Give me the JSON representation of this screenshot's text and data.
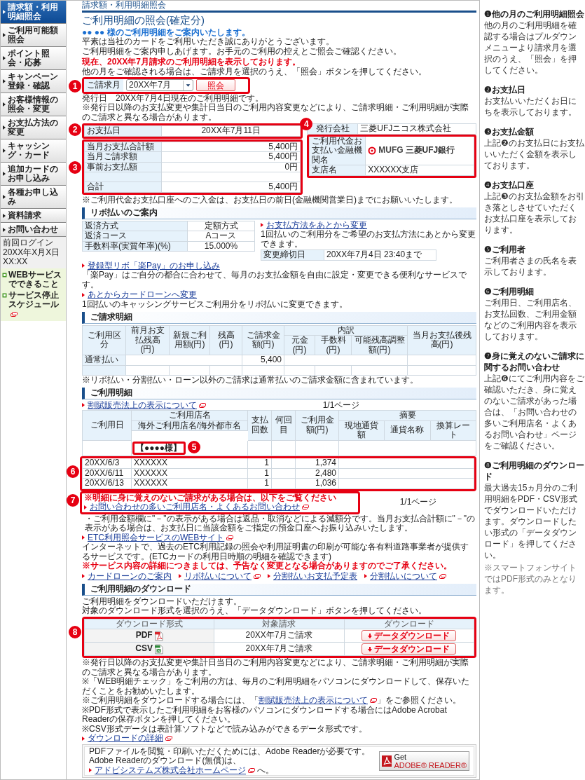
{
  "sidebar": {
    "items": [
      {
        "label": "請求額・利用明細照会",
        "selected": true
      },
      {
        "label": "ご利用可能額照会",
        "selected": false
      },
      {
        "label": "ポイント照会・応募",
        "selected": false
      },
      {
        "label": "キャンペーン登録・確認",
        "selected": false
      },
      {
        "label": "お客様情報の照会・変更",
        "selected": false
      },
      {
        "label": "お支払方法の変更",
        "selected": false
      },
      {
        "label": "キャッシング・カード",
        "selected": false
      },
      {
        "label": "追加カードのお申し込み",
        "selected": false
      },
      {
        "label": "各種お申し込み",
        "selected": false
      },
      {
        "label": "資料請求",
        "selected": false
      },
      {
        "label": "お問い合わせ",
        "selected": false
      }
    ],
    "last_login": {
      "label": "前回ログイン",
      "value": "20XX年X月X日 XX:XX"
    },
    "links": [
      {
        "label": "WEBサービスでできること",
        "external": false
      },
      {
        "label": "サービス停止スケジュール",
        "external": true
      }
    ]
  },
  "breadcrumb": "請求額・利用明細照会",
  "title": "ご利用明細の照会(確定分)",
  "greeting": "●● ●● 様のご利用明細をご案内いたします。",
  "intro": [
    "平素は当社のカードをご利用いただき誠にありがとうございます。",
    "ご利用明細をご案内申しあげます。お手元のご利用の控えとご照会ご確認ください。"
  ],
  "current_notice": "現在、20XX年7月請求のご利用明細を表示しております。",
  "other_month_notice": "他の月をご確認される場合は、ご請求月を選択のうえ、「照会」ボタンを押してください。",
  "month_selector": {
    "badge": "1",
    "label": "ご請求月",
    "value": "20XX年7月",
    "button": "照会"
  },
  "issue_date": "発行日　20XX年7月4日現在のご利用明細です。",
  "issue_note": "※発行日以降のお支払変更や集計日当日のご利用内容変更などにより、ご請求明細・ご利用明細が実際のご請求と異なる場合があります。",
  "payment": {
    "date_badge": "2",
    "amount_badge": "3",
    "date_label": "お支払日",
    "date_value": "20XX年7月11日",
    "rows": [
      {
        "kind": "amount",
        "label": "当月お支払合計額",
        "value": "5,400円"
      },
      {
        "kind": "amount",
        "label": "当月ご請求額",
        "value": "5,400円"
      },
      {
        "kind": "amount",
        "label": "事前お支払額",
        "value": "0円"
      },
      {
        "kind": "blank"
      },
      {
        "kind": "amount",
        "label": "合計",
        "value": "5,400円"
      }
    ]
  },
  "account": {
    "badge": "4",
    "issuer_label": "発行会社",
    "issuer_value": "三菱UFJニコス株式会社",
    "bank_label": "ご利用代金お支払い金融機関名",
    "bank_logo": "MUFG",
    "bank_name": "三菱UFJ銀行",
    "branch_label": "支店名",
    "branch_value": "XXXXXX支店"
  },
  "account_note": "※ご利用代金お支払口座へのご入金は、お支払日の前日(金融機関営業日)までにお願いいたします。",
  "revo": {
    "heading": "リボ払いのご案内",
    "rows": [
      {
        "label": "返済方式",
        "value": "定額方式"
      },
      {
        "label": "返済コース",
        "value": "Aコース"
      },
      {
        "label": "手数料率(実質年率)(%)",
        "value": "15.000%"
      }
    ],
    "items": [
      {
        "link": "お支払方法をあとから変更",
        "text": "1回払いのご利用分をご希望のお支払方法にあとから変更できます。",
        "deadline": {
          "label": "変更締切日",
          "value": "20XX年7月4日 23:40まで"
        }
      },
      {
        "link": "登録型リボ「楽Pay」のお申し込み",
        "text": "「楽Pay」はご自分の都合に合わせて、毎月のお支払金額を自由に設定・変更できる便利なサービスです。"
      },
      {
        "link": "あとからカードローンへ変更",
        "text": "1回払いのキャッシングサービスご利用分をリボ払いに変更できます。"
      }
    ]
  },
  "billing": {
    "heading": "ご請求明細",
    "columns": [
      "ご利用区分",
      "前月お支払残高(円)",
      "新規ご利用額(円)",
      "残高(円)",
      "ご請求金額(円)",
      "内訳",
      "当月お支払後残高(円)"
    ],
    "breakdown": [
      "元金(円)",
      "手数料(円)",
      "可能残高調整額(円)"
    ],
    "rows": [
      {
        "category": "通常払い",
        "amount": "5,400"
      }
    ],
    "note": "※リボ払い・分割払い・ローン以外のご請求は通常払いのご請求金額に含まれています。"
  },
  "usage": {
    "heading": "ご利用明細",
    "legal_link": "割賦販売法上の表示について",
    "page_top": "1/1ページ",
    "columns": {
      "date": "ご利用日",
      "store": "ご利用店名",
      "store_sub": "海外ご利用店名/海外都市名",
      "count": "支払回数",
      "nth": "何回目",
      "amount": "ご利用金額(円)",
      "remarks": "摘要",
      "remarks_sub": [
        "現地通貨額",
        "通貨名称",
        "換算レート"
      ]
    },
    "user_badge": "5",
    "user": "【●●●●様】",
    "rows_badge": "6",
    "rows": [
      {
        "date": "20XX/6/3",
        "store": "XXXXXX",
        "count": "1",
        "amount": "1,374"
      },
      {
        "date": "20XX/6/11",
        "store": "XXXXXX",
        "count": "1",
        "amount": "2,480"
      },
      {
        "date": "20XX/6/13",
        "store": "XXXXXX",
        "count": "1",
        "amount": "1,036"
      }
    ],
    "page_bottom": "1/1ページ",
    "inquiry": {
      "badge": "7",
      "warning": "※明細に身に覚えのないご請求がある場合は、以下をご覧ください",
      "link": "お問い合わせの多いご利用店名・よくあるお問い合わせ"
    },
    "note": "・ご利用金額欄に\"－\"の表示がある場合は返品・取消などによる減額分です。当月お支払合計額に\"－\"の表示がある場合は、お支払日に当該金額をご指定の預金口座へお振り込みいたします。",
    "etc": {
      "link": "ETC利用照会サービスのWEBサイト",
      "text": "インターネットで、過去のETC利用記録の照会や利用証明書の印刷が可能な各有料道路事業者が提供するサービスです。(ETCカードの利用日時順の明細を確認できます)"
    },
    "disclaimer": "※サービス内容の詳細につきましては、予告なく変更となる場合がありますのでご了承ください。",
    "links": [
      {
        "label": "カードローンのご案内",
        "external": false
      },
      {
        "label": "リボ払いについて",
        "external": true
      },
      {
        "label": "分割払いお支払予定表",
        "external": false
      },
      {
        "label": "分割払いについて",
        "external": true
      }
    ]
  },
  "download": {
    "heading": "ご利用明細のダウンロード",
    "intro": [
      "ご利用明細をダウンロードいただけます。",
      "対象のダウンロード形式を選択のうえ、「データダウンロード」ボタンを押してください。"
    ],
    "badge": "8",
    "columns": [
      "ダウンロード形式",
      "対象請求",
      "ダウンロード"
    ],
    "rows": [
      {
        "kind": "pdf",
        "format": "PDF",
        "target": "20XX年7月ご請求",
        "button": "データダウンロード"
      },
      {
        "kind": "csv",
        "format": "CSV",
        "target": "20XX年7月ご請求",
        "button": "データダウンロード"
      }
    ],
    "notes": [
      {
        "before": "※発行日以降のお支払変更や集計日当日のご利用内容変更などにより、ご請求明細・ご利用明細が実際のご請求と異なる場合があります。"
      },
      {
        "before": "※「WEB明細チェック」をご利用の方は、毎月のご利用明細をパソコンにダウンロードして、保存いただくことをお勧めいたします。"
      },
      {
        "before": "※ご利用明細をダウンロードする場合には、「",
        "link": "割賦販売法上の表示について",
        "after": "」をご参照ください。"
      },
      {
        "before": "※PDF形式で表示したご利用明細をお客様のパソコンにダウンロードする場合にはAdobe Acrobat Readerの保存ボタンを押してください。"
      },
      {
        "before": "※CSV形式データは表計算ソフトなどで読み込みができるデータ形式です。"
      }
    ],
    "detail_link": "ダウンロードの詳細",
    "adobe": {
      "lines": [
        "PDFファイルを閲覧・印刷いただくためには、Adobe Readerが必要です。",
        "Adobe Readerのダウンロード(無償)は、"
      ],
      "link": "アドビシステムズ株式会社ホームページ",
      "suffix": "へ。",
      "badge_top": "Get",
      "badge_bottom": "ADOBE® READER®"
    }
  },
  "guide": [
    {
      "heading": "❶他の月のご利用明細照会",
      "body": "他の月のご利用明細を確認する場合はプルダウンメニューより請求月を選択のうえ、「照会」を押してください。"
    },
    {
      "heading": "❷お支払日",
      "body": "お支払いいただくお日にちを表示しております。"
    },
    {
      "heading": "❸お支払金額",
      "body": "上記❷のお支払日にお支払いいただく金額を表示しております。"
    },
    {
      "heading": "❹お支払口座",
      "body": "上記❸のお支払金額をお引き落としさせていただくお支払口座を表示しております。"
    },
    {
      "heading": "❺ご利用者",
      "body": "ご利用者さまの氏名を表示しております。"
    },
    {
      "heading": "❻ご利用明細",
      "body": "ご利用日、ご利用店名、お支払回数、ご利用金額などのご利用内容を表示しております。"
    },
    {
      "heading": "❼身に覚えのないご請求に関するお問い合わせ",
      "body": "上記❻にてご利用内容をご確認いただき、身に覚えのないご請求があった場合は、「お問い合わせの多いご利用店名・よくあるお問い合わせ」ページをご確認ください。"
    },
    {
      "heading": "❽ご利用明細のダウンロード",
      "body": "最大過去15ヵ月分のご利用明細をPDF・CSV形式でダウンロードいただけます。ダウンロードしたい形式の「データダウンロード」を押してください。"
    }
  ],
  "guide_footnote": "※スマートフォンサイトではPDF形式のみとなります。"
}
